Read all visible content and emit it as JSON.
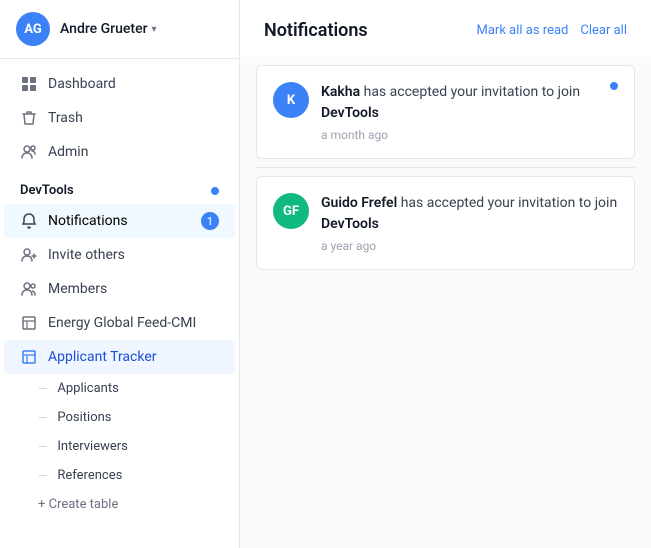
{
  "sidebar": {
    "user": {
      "initials": "AG",
      "name": "Andre Grueter",
      "chevron": "▾"
    },
    "nav": [
      {
        "id": "dashboard",
        "label": "Dashboard",
        "icon": "⊞"
      },
      {
        "id": "trash",
        "label": "Trash",
        "icon": "🗑"
      },
      {
        "id": "admin",
        "label": "Admin",
        "icon": "👥"
      }
    ],
    "workspace": {
      "title": "DevTools",
      "items": [
        {
          "id": "notifications",
          "label": "Notifications",
          "badge": "1"
        },
        {
          "id": "invite",
          "label": "Invite others"
        },
        {
          "id": "members",
          "label": "Members"
        },
        {
          "id": "energy",
          "label": "Energy Global Feed-CMI"
        },
        {
          "id": "applicant-tracker",
          "label": "Applicant Tracker"
        }
      ],
      "sub_items": [
        {
          "id": "applicants",
          "label": "Applicants"
        },
        {
          "id": "positions",
          "label": "Positions"
        },
        {
          "id": "interviewers",
          "label": "Interviewers"
        },
        {
          "id": "references",
          "label": "References"
        }
      ],
      "create_table": "+ Create table"
    }
  },
  "main": {
    "title": "Notifications",
    "actions": {
      "mark_all_read": "Mark all as read",
      "clear": "Clear all"
    },
    "notifications": [
      {
        "id": "notif1",
        "initials": "K",
        "avatar_color": "blue",
        "sender": "Kakha",
        "action": "has accepted your invitation to join",
        "target": "DevTools",
        "time": "a month ago",
        "unread": true
      },
      {
        "id": "notif2",
        "initials": "GF",
        "avatar_color": "green",
        "sender": "Guido Frefel",
        "action": "has accepted your invitation to join",
        "target": "DevTools",
        "time": "a year ago",
        "unread": false
      }
    ]
  }
}
